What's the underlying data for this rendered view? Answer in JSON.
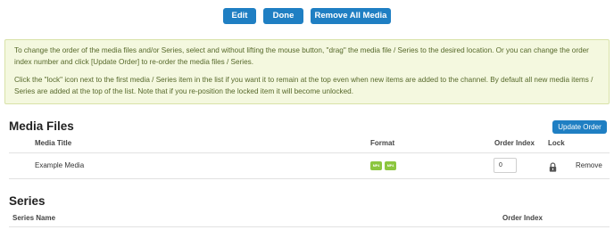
{
  "toolbar": {
    "edit_label": "Edit",
    "done_label": "Done",
    "remove_all_label": "Remove All Media"
  },
  "notice": {
    "paragraph1": "To change the order of the media files and/or Series, select and without lifting the mouse button, \"drag\" the media file / Series to the desired location. Or you can change the order index number and click [Update Order] to re-order the media files / Series.",
    "paragraph2": "Click the \"lock\" icon next to the first media / Series item in the list if you want it to remain at the top even when new items are added to the channel. By default all new media items / Series are added at the top of the list. Note that if you re-position the locked item it will become unlocked."
  },
  "media_files": {
    "title": "Media Files",
    "update_order_label": "Update Order",
    "columns": {
      "media_title": "Media Title",
      "format": "Format",
      "order_index": "Order Index",
      "lock": "Lock"
    },
    "rows": [
      {
        "title": "Example Media",
        "formats": [
          "MP4",
          "MP4"
        ],
        "order_index": "0",
        "lock_icon": "lock-icon",
        "remove_label": "Remove"
      }
    ]
  },
  "series": {
    "title": "Series",
    "columns": {
      "series_name": "Series Name",
      "order_index": "Order Index"
    }
  },
  "colors": {
    "button_blue": "#1f7fc3",
    "notice_background": "#f4f8df",
    "notice_text": "#56682a",
    "format_badge": "#8cc63f"
  }
}
